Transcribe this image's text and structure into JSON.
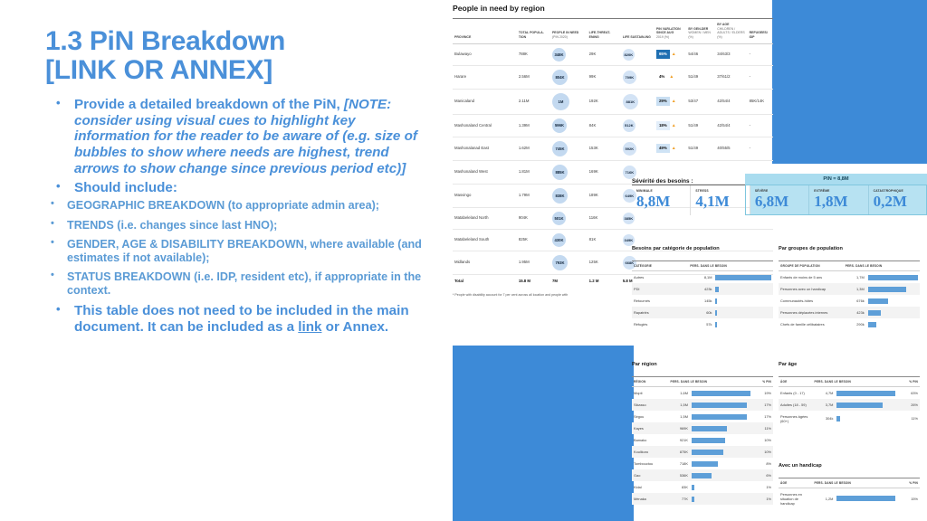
{
  "slide": {
    "title_line1": "1.3 PiN Breakdown",
    "title_line2": "[LINK OR ANNEX]",
    "accent_color": "#4a90d9",
    "bullets": [
      {
        "normal": "Provide a detailed breakdown of the PiN, ",
        "italic": "[NOTE: consider using visual cues to highlight key information for the reader to be aware of (e.g. size of bubbles to show where needs are highest, trend arrows to show change since previous period etc)]"
      },
      {
        "normal": "Should include:",
        "italic": ""
      }
    ],
    "sub_bullets": [
      "GEOGRAPHIC BREAKDOWN (to appropriate admin area);",
      "TRENDS (i.e. changes since last HNO);",
      "GENDER, AGE & DISABILITY BREAKDOWN, where available (and estimates if not available);",
      "STATUS BREAKDOWN (i.e. IDP, resident etc), if appropriate in the context."
    ],
    "final_bullet": {
      "part1": "This table does not need to be included in the main document. It can be included as a ",
      "link": "link",
      "part2": " or Annex."
    }
  },
  "pin_table": {
    "title": "People in need by region",
    "columns": [
      {
        "label": "PROVINCE",
        "sub": ""
      },
      {
        "label": "TOTAL POPULA-TION",
        "sub": ""
      },
      {
        "label": "PEOPLE IN NEED",
        "sub": "(PIN 2020)"
      },
      {
        "label": "LIFE-THREAT-ENING",
        "sub": ""
      },
      {
        "label": "LIFE SUSTAIN-ING",
        "sub": ""
      },
      {
        "label": "PIN VARI-ATION SINCE AUG",
        "sub": "2019 (%)"
      },
      {
        "label": "BY GEN-DER",
        "sub": "WOMEN / MEN (%)"
      },
      {
        "label": "BY AGE",
        "sub": "CHILDREN / ADULTS / ELDERS (%)"
      },
      {
        "label": "REFUGEES/ IDP",
        "sub": ""
      }
    ],
    "rows": [
      {
        "province": "Bulawayo",
        "total_pop": "788K",
        "pin": "348K",
        "life_threat": "29K",
        "life_sustain": "820K",
        "pin_var": "65%",
        "trend": "up",
        "gender": "54/46",
        "age": "34/63/3",
        "refugees": "-"
      },
      {
        "province": "Harare",
        "total_pop": "2.56M",
        "pin": "804K",
        "life_threat": "99K",
        "life_sustain": "709K",
        "pin_var": "4%",
        "trend": "up",
        "gender": "51/49",
        "age": "37/61/2",
        "refugees": "-"
      },
      {
        "province": "Manicaland",
        "total_pop": "2.11M",
        "pin": "1M",
        "life_threat": "192K",
        "life_sustain": "881K",
        "pin_var": "29%",
        "trend": "up",
        "gender": "53/47",
        "age": "42/54/4",
        "refugees": "85K/14K"
      },
      {
        "province": "Mashonaland Central",
        "total_pop": "1.39M",
        "pin": "596K",
        "life_threat": "84K",
        "life_sustain": "512K",
        "pin_var": "18%",
        "trend": "up",
        "gender": "51/49",
        "age": "42/54/4",
        "refugees": "-"
      },
      {
        "province": "Mashonalanad East",
        "total_pop": "1.62M",
        "pin": "745K",
        "life_threat": "153K",
        "life_sustain": "592K",
        "pin_var": "49%",
        "trend": "up",
        "gender": "51/49",
        "age": "40/55/5",
        "refugees": "-"
      },
      {
        "province": "Mashonaland West",
        "total_pop": "1.81M",
        "pin": "885K",
        "life_threat": "169K",
        "life_sustain": "716K",
        "pin_var": "",
        "trend": "",
        "gender": "",
        "age": "",
        "refugees": ""
      },
      {
        "province": "Masvingo",
        "total_pop": "1.79M",
        "pin": "838K",
        "life_threat": "189K",
        "life_sustain": "649K",
        "pin_var": "",
        "trend": "",
        "gender": "",
        "age": "",
        "refugees": ""
      },
      {
        "province": "Matabeleland North",
        "total_pop": "904K",
        "pin": "501K",
        "life_threat": "116K",
        "life_sustain": "385K",
        "pin_var": "",
        "trend": "",
        "gender": "",
        "age": "",
        "refugees": ""
      },
      {
        "province": "Matabeleland South",
        "total_pop": "825K",
        "pin": "430K",
        "life_threat": "81K",
        "life_sustain": "349K",
        "pin_var": "",
        "trend": "",
        "gender": "",
        "age": "",
        "refugees": ""
      },
      {
        "province": "Midlands",
        "total_pop": "1.95M",
        "pin": "793K",
        "life_threat": "125K",
        "life_sustain": "668K",
        "pin_var": "",
        "trend": "",
        "gender": "",
        "age": "",
        "refugees": ""
      }
    ],
    "total_row": {
      "province": "Total",
      "total_pop": "15.8 M",
      "pin": "7M",
      "life_threat": "1.2 M",
      "life_sustain": "5.8 M",
      "pin_var": "",
      "gender": "",
      "age": "",
      "refugees": ""
    },
    "footnote": "* People with disability account for 7 per cent across all location and people with"
  },
  "severity": {
    "title": "Sévérité des besoins :",
    "pin_banner": "PIN = 8,8M",
    "cells": [
      {
        "caption": "MINIMALE",
        "value": "8,8M",
        "highlight": false
      },
      {
        "caption": "STRESS",
        "value": "4,1M",
        "highlight": false
      },
      {
        "caption": "SÉVÈRE",
        "value": "6,8M",
        "highlight": true
      },
      {
        "caption": "EXTRÊME",
        "value": "1,8M",
        "highlight": true
      },
      {
        "caption": "CATASTROPHIQUE",
        "value": "0,2M",
        "highlight": true
      }
    ]
  },
  "by_category": {
    "title": "Besoins par catégorie de population",
    "columns": [
      "CATÉGORIE",
      "PERS. DANS LE BESOIN"
    ],
    "rows": [
      {
        "label": "Autres",
        "value": "8,1M",
        "bar_pct": 100
      },
      {
        "label": "PDI",
        "value": "423k",
        "bar_pct": 5
      },
      {
        "label": "Retournés",
        "value": "145k",
        "bar_pct": 2
      },
      {
        "label": "Rapatriés",
        "value": "60k",
        "bar_pct": 1
      },
      {
        "label": "Réfugiés",
        "value": "57k",
        "bar_pct": 1
      }
    ]
  },
  "by_group": {
    "title": "Par groupes de population",
    "columns": [
      "GROUPE DE POPULATION",
      "PERS. DANS LE BESOIN"
    ],
    "rows": [
      {
        "label": "Enfants de moins de 5 ans",
        "value": "1,7M",
        "bar_pct": 100
      },
      {
        "label": "Personnes avec un handicap",
        "value": "1,3M",
        "bar_pct": 76
      },
      {
        "label": "Communautés-hôtes",
        "value": "676k",
        "bar_pct": 40
      },
      {
        "label": "Personnes déplacées internes",
        "value": "423k",
        "bar_pct": 25
      },
      {
        "label": "Chefs de famille célibataires",
        "value": "290k",
        "bar_pct": 17
      }
    ]
  },
  "by_region": {
    "title": "Par région",
    "columns": [
      "RÉGION",
      "PERS. DANS LE BESOIN",
      "% PIN"
    ],
    "rows": [
      {
        "label": "Mopti",
        "value": "1,6M",
        "bar_pct": 100,
        "pct": "19%"
      },
      {
        "label": "Sikasso",
        "value": "1,5M",
        "bar_pct": 94,
        "pct": "17%"
      },
      {
        "label": "Ségou",
        "value": "1,5M",
        "bar_pct": 94,
        "pct": "17%"
      },
      {
        "label": "Kayes",
        "value": "969K",
        "bar_pct": 61,
        "pct": "11%"
      },
      {
        "label": "Bamako",
        "value": "921K",
        "bar_pct": 58,
        "pct": "10%"
      },
      {
        "label": "Koulikoro",
        "value": "875K",
        "bar_pct": 55,
        "pct": "10%"
      },
      {
        "label": "Tombouctou",
        "value": "718K",
        "bar_pct": 45,
        "pct": "8%"
      },
      {
        "label": "Gao",
        "value": "536K",
        "bar_pct": 34,
        "pct": "6%"
      },
      {
        "label": "Kidal",
        "value": "83K",
        "bar_pct": 5,
        "pct": "1%"
      },
      {
        "label": "Ménaka",
        "value": "77K",
        "bar_pct": 5,
        "pct": "1%"
      }
    ]
  },
  "by_age": {
    "title": "Par âge",
    "columns": [
      "ÂGE",
      "PERS. DANS LE BESOIN",
      "% PIN"
    ],
    "rows": [
      {
        "label": "Enfants (0 - 17)",
        "value": "4,7M",
        "bar_pct": 100,
        "pct": "63%"
      },
      {
        "label": "Adultes (18 - 59)",
        "value": "3,7M",
        "bar_pct": 79,
        "pct": "26%"
      },
      {
        "label": "Personnes âgées (60+)",
        "value": "304k",
        "bar_pct": 6,
        "pct": "11%"
      }
    ]
  },
  "disability": {
    "title": "Avec un handicap",
    "columns": [
      "ÂGE",
      "PERS. DANS LE BESOIN",
      "% PIN"
    ],
    "rows": [
      {
        "label": "Personnes en situation de handicap",
        "value": "1,2M",
        "bar_pct": 100,
        "pct": "15%"
      }
    ]
  }
}
